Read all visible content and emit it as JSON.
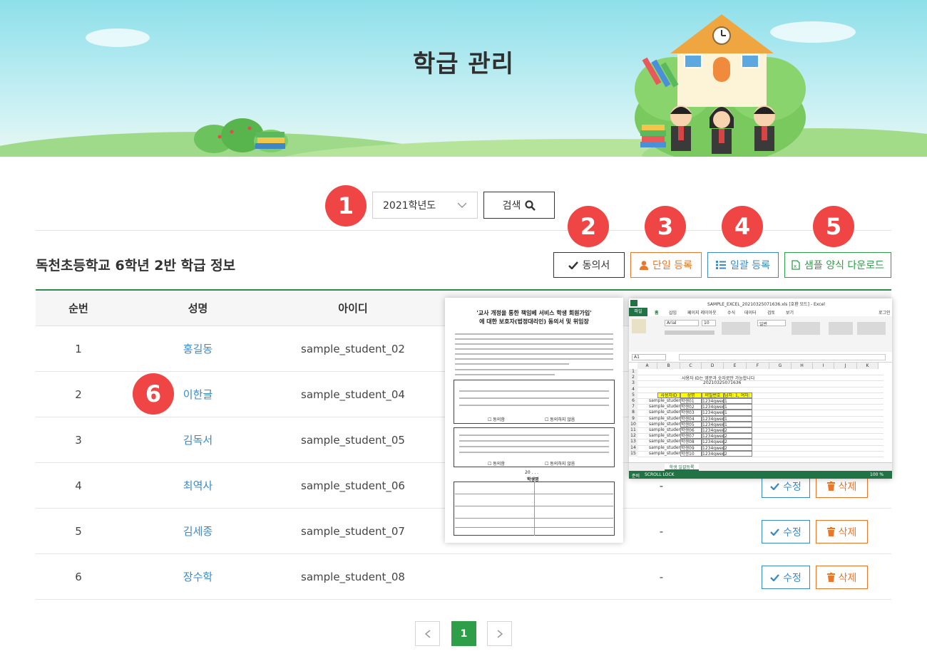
{
  "page": {
    "title": "학급 관리"
  },
  "search": {
    "year_value": "2021학년도",
    "button_label": "검색"
  },
  "section": {
    "title": "독천초등학교 6학년 2반 학급 정보"
  },
  "actions": {
    "consent": "동의서",
    "single_register": "단일 등록",
    "bulk_register": "일괄 등록",
    "sample_download": "샘플 양식 다운로드"
  },
  "badges": [
    "1",
    "2",
    "3",
    "4",
    "5",
    "6"
  ],
  "table": {
    "headers": {
      "no": "순번",
      "name": "성명",
      "id": "아이디"
    },
    "rows": [
      {
        "no": "1",
        "name": "홍길동",
        "id": "sample_student_02",
        "extra": "-"
      },
      {
        "no": "2",
        "name": "이한글",
        "id": "sample_student_04",
        "extra": "-"
      },
      {
        "no": "3",
        "name": "김독서",
        "id": "sample_student_05",
        "extra": "-"
      },
      {
        "no": "4",
        "name": "최역사",
        "id": "sample_student_06",
        "extra": "-"
      },
      {
        "no": "5",
        "name": "김세종",
        "id": "sample_student_07",
        "extra": "-"
      },
      {
        "no": "6",
        "name": "장수학",
        "id": "sample_student_08",
        "extra": "-"
      }
    ],
    "edit_label": "수정",
    "delete_label": "삭제"
  },
  "pagination": {
    "current": "1"
  },
  "consent_form": {
    "title_line1": "'교사 개정을 통한 책임베 서비스 학생 회원가입'",
    "title_line2": "에 대한 보호자(법정대리인) 동의서 및 위임장",
    "agree": "☐ 동의함",
    "disagree": "☐ 동의하지 않음",
    "date": "20 .  .  .",
    "signer": "학생명"
  },
  "excel": {
    "window_title": "SAMPLE_EXCEL_20210325071636.xls [호환 모드] - Excel",
    "tabs": [
      "파일",
      "홈",
      "삽입",
      "페이지 레이아웃",
      "수식",
      "데이터",
      "검토",
      "보기"
    ],
    "login": "로그인",
    "cell_ref": "A1",
    "font_name": "Arial",
    "font_size": "10",
    "number_format": "일반",
    "note": "사용자 ID는 영문과 숫자로만 가능합니다",
    "timestamp": "20210325071636",
    "col_headers": [
      "A",
      "B",
      "C",
      "D",
      "E",
      "F",
      "G",
      "H",
      "I",
      "J",
      "K"
    ],
    "table_headers": [
      "사용자ID",
      "성명",
      "비밀번호",
      "남자: 1, 여자: 2)"
    ],
    "rows": [
      [
        "sample_studen",
        "학생01",
        "1234qwer!@",
        "1"
      ],
      [
        "sample_studen",
        "학생02",
        "1234qwer!@",
        "1"
      ],
      [
        "sample_studen",
        "학생03",
        "1234qwer!@",
        "1"
      ],
      [
        "sample_studen",
        "학생04",
        "1234qwer!@",
        "1"
      ],
      [
        "sample_studen",
        "학생05",
        "1234qwer!@",
        "1"
      ],
      [
        "sample_studen",
        "학생06",
        "1234qwer!@",
        "2"
      ],
      [
        "sample_studen",
        "학생07",
        "1234qwer!@",
        "2"
      ],
      [
        "sample_studen",
        "학생08",
        "1234qwer!@",
        "2"
      ],
      [
        "sample_studen",
        "학생09",
        "1234qwer!@",
        "2"
      ],
      [
        "sample_studen",
        "학생10",
        "1234qwer!@",
        "2"
      ]
    ],
    "sheet_tab": "학생 일괄등록",
    "status_ready": "준비",
    "status_scroll": "SCROLL LOCK",
    "zoom": "100 %"
  },
  "colors": {
    "badge": "#ef4545",
    "header_rule": "#2e8b4a",
    "link": "#3a89c9",
    "single_register": "#e8782c",
    "bulk_register": "#3a89c9",
    "sample_download": "#2e9e48",
    "pagination_active": "#2e9e48",
    "excel_green": "#217346"
  }
}
